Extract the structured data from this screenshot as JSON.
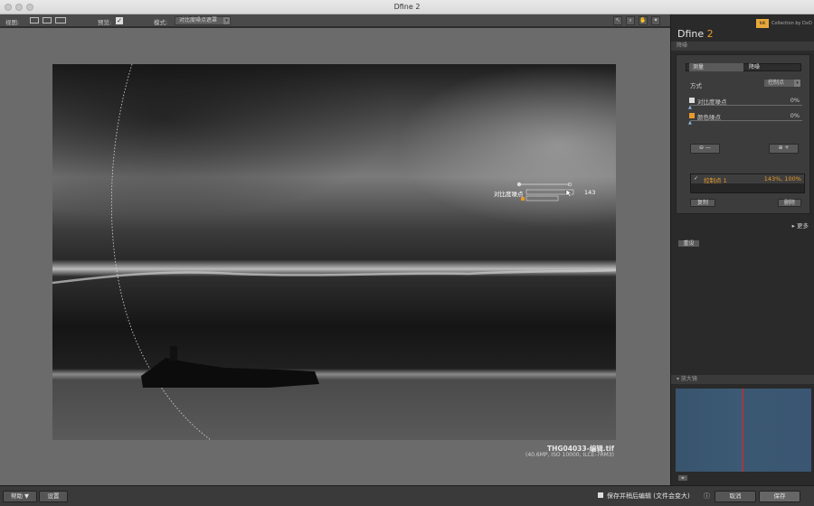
{
  "window": {
    "title": "Dfine 2"
  },
  "toolbar": {
    "view_label": "视图:",
    "preview_label": "预览:",
    "preview_checked": "✓",
    "mode_label": "模式:",
    "mode_value": "对比度噪点遮罩"
  },
  "canvas": {
    "control_point": {
      "label": "对比度噪点",
      "value": "143"
    },
    "file_name": "THG04033-编辑.tif",
    "file_info": "(40.6MP, ISO 10000, ILCE-7RM3)"
  },
  "panel": {
    "brand_badge": "NIK",
    "brand_text": "Collection by DxO",
    "title_main": "Dfine",
    "title_num": "2",
    "section_noise": "降噪",
    "tabs": [
      "测量",
      "降噪"
    ],
    "method_label": "方式",
    "method_value": "控制点",
    "contrast_noise_label": "对比度噪点",
    "contrast_noise_value": "0%",
    "color_noise_label": "颜色噪点",
    "color_noise_value": "0%",
    "cp_item_label": "控制点 1",
    "cp_item_value": "143%, 100%",
    "copy_label": "复制",
    "delete_label": "删除",
    "more_label": "▸ 更多",
    "reset_label": "重设",
    "loupe_section": "放大镜"
  },
  "bottom": {
    "help_label": "帮助 ▼",
    "settings_label": "设置",
    "save_edit_label": "保存并稍后编辑 (文件会变大)",
    "cancel_label": "取消",
    "save_label": "保存"
  },
  "colors": {
    "accent": "#e89a2c",
    "loupe_line": "#c03030"
  }
}
